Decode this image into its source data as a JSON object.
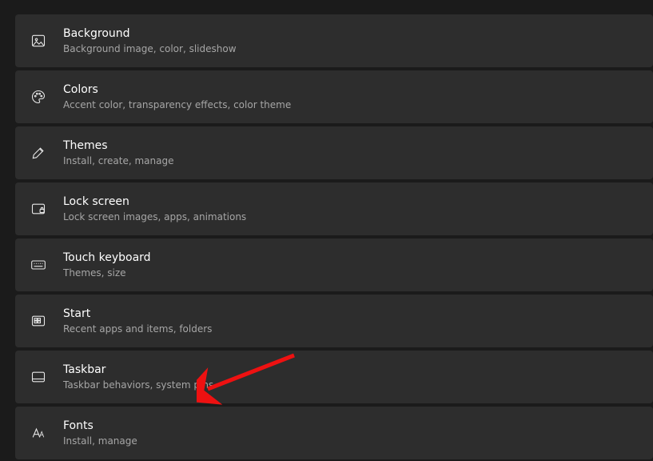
{
  "items": [
    {
      "title": "Background",
      "desc": "Background image, color, slideshow"
    },
    {
      "title": "Colors",
      "desc": "Accent color, transparency effects, color theme"
    },
    {
      "title": "Themes",
      "desc": "Install, create, manage"
    },
    {
      "title": "Lock screen",
      "desc": "Lock screen images, apps, animations"
    },
    {
      "title": "Touch keyboard",
      "desc": "Themes, size"
    },
    {
      "title": "Start",
      "desc": "Recent apps and items, folders"
    },
    {
      "title": "Taskbar",
      "desc": "Taskbar behaviors, system pins"
    },
    {
      "title": "Fonts",
      "desc": "Install, manage"
    }
  ],
  "annotation": {
    "points_at_index": 6
  }
}
